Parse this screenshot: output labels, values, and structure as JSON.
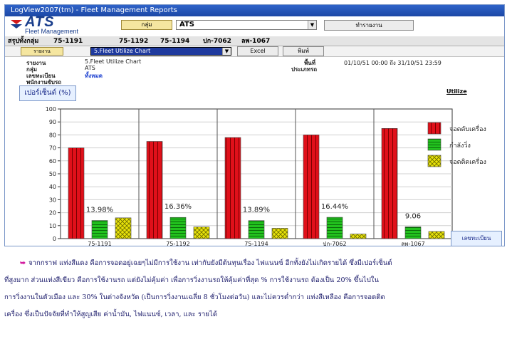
{
  "window": {
    "title": "LogView2007(tm) - Fleet Management Reports"
  },
  "header": {
    "logo_text": "ATS",
    "logo_sub": "Fleet Management",
    "group_label": "กลุ่ม",
    "group_value": "ATS",
    "report_button": "ทำรายงาน"
  },
  "vehicle_tabs": {
    "summary_label": "สรุปทั้งกลุ่ม",
    "items": [
      "75-1191",
      "75-1192",
      "75-1194",
      "ปก-7062",
      "ลพ-1067"
    ]
  },
  "toolbar": {
    "report_type_button": "รายงาน",
    "chart_select": "5.Fleet Utilize Chart",
    "excel_button": "Excel",
    "print_button": "พิมพ์"
  },
  "report_info": {
    "report_label": "รายงาน",
    "report_value": "5.Fleet Utilize Chart",
    "group_label": "กลุ่ม",
    "group_value": "ATS",
    "plate_label": "เลขทะเบียน",
    "plate_value": "ทั้งหมด",
    "driver_label": "พนักงานขับรถ",
    "area_label": "พื้นที่",
    "date_range": "01/10/51  00:00 ถึง 31/10/51  23:59",
    "vehicle_type_label": "ประเภทรถ"
  },
  "chart_panel": {
    "ylabel": "เปอร์เซ็นต์ (%)",
    "xlabel": "เลขทะเบียน",
    "corner_label": "Utilize"
  },
  "chart_data": {
    "type": "bar",
    "categories": [
      "75-1191",
      "75-1192",
      "75-1194",
      "ปก-7062",
      "ลพ-1067"
    ],
    "series": [
      {
        "name": "จอดดับเครื่อง",
        "values": [
          70,
          75,
          78,
          80,
          85
        ],
        "color": "#e0101a"
      },
      {
        "name": "กำลังวิ่ง",
        "values": [
          13.98,
          16.36,
          13.89,
          16.44,
          9.06
        ],
        "color": "#22c21e"
      },
      {
        "name": "จอดติดเครื่อง",
        "values": [
          16,
          9,
          8,
          3.5,
          5.5
        ],
        "color": "#e8e20a"
      }
    ],
    "data_labels": [
      "13.98%",
      "16.36%",
      "13.89%",
      "16.44%",
      "9.06"
    ],
    "ylim": [
      0,
      100
    ],
    "yticks": [
      0,
      10,
      20,
      30,
      40,
      50,
      60,
      70,
      80,
      90,
      100
    ],
    "grid": true,
    "legend": "right"
  },
  "caption": {
    "line1": "จากกราฟ แท่งสีแดง คือการจอดอยู่เฉยๆไม่มีการใช้งาน เท่ากับยังมีต้นทุนเรื่อง ไฟแนนซ์ อีกทั้งยังไม่เกิดรายได้ ซึ่งมีเปอร์เซ็นต์",
    "line2": "ที่สูงมาก ส่วนแท่งสีเขียว คือการใช้งานรถ แต่ยังไม่คุ้มค่า เพื่อการวิ่งงานรถให้คุ้มค่าที่สุด % การใช้งานรถ ต้องเป็น 20% ขึ้นไปใน",
    "line3": "การวิ่งงานในตัวเมือง และ 30% ในต่างจังหวัด (เป็นการวิ่งงานเฉลี่ย 8 ชั่วโมงต่อวัน) และไม่ควรต่ำกว่า แท่งสีเหลือง คือการจอดติด",
    "line4": "เครื่อง ซึ่งเป็นปัจจัยที่ทำให้สูญเสีย ค่าน้ำมัน, ไฟแนนซ์, เวลา, และ รายได้"
  }
}
